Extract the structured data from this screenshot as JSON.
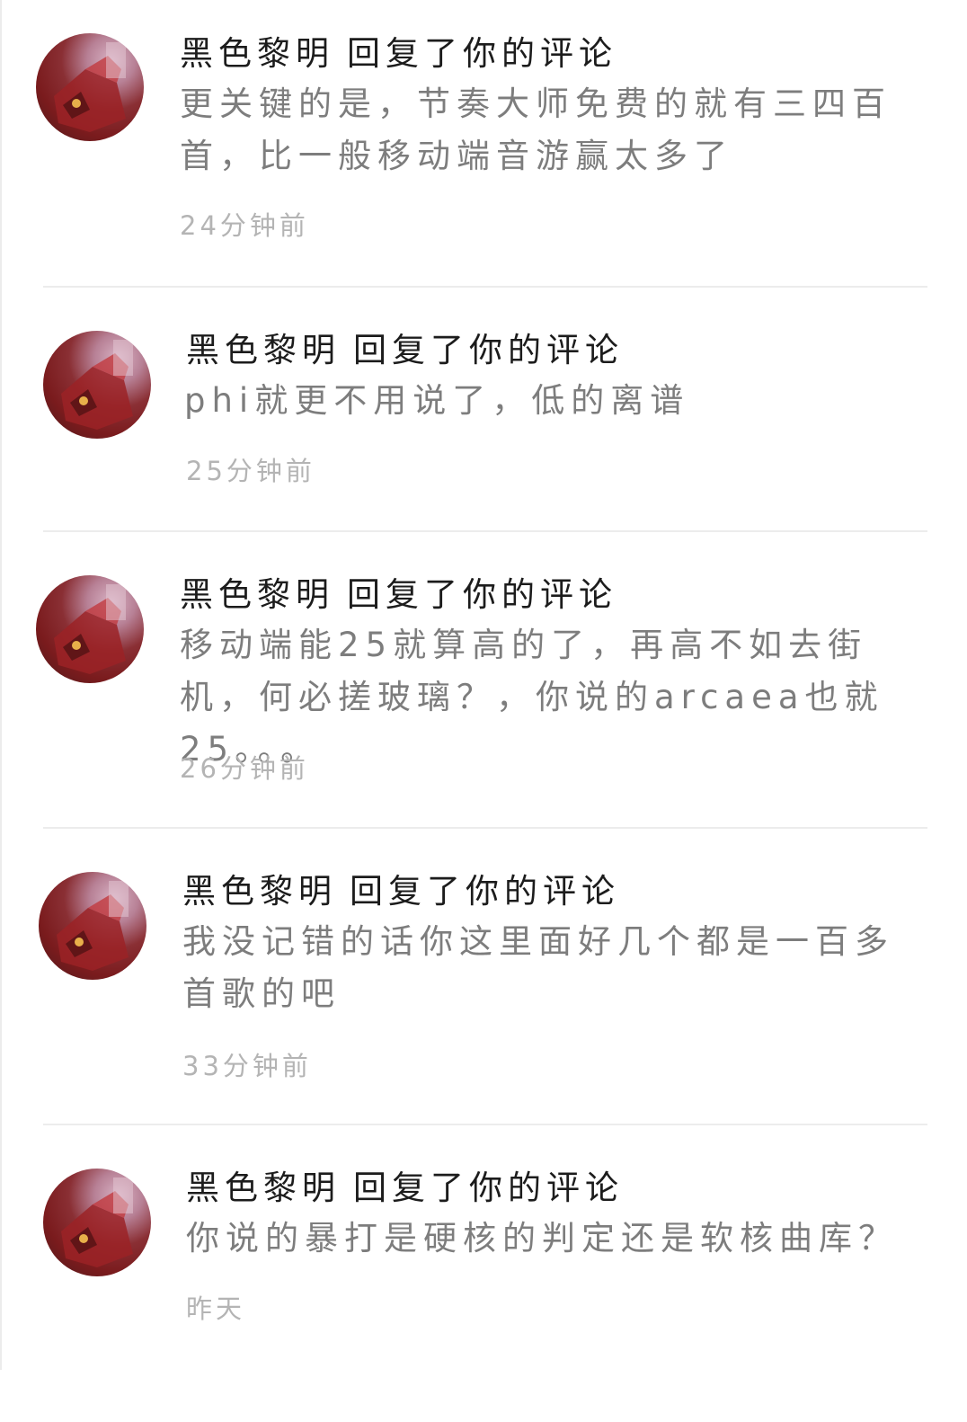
{
  "notifications": [
    {
      "user": "黑色黎明",
      "action": "回复了你的评论",
      "text": "更关键的是，节奏大师免费的就有三四百首，比一般移动端音游赢太多了",
      "time": "24分钟前",
      "avatar_icon": "user-avatar"
    },
    {
      "user": "黑色黎明",
      "action": "回复了你的评论",
      "text": "phi就更不用说了，低的离谱",
      "time": "25分钟前",
      "avatar_icon": "user-avatar"
    },
    {
      "user": "黑色黎明",
      "action": "回复了你的评论",
      "text": "移动端能25就算高的了，再高不如去街机，何必搓玻璃？，你说的arcaea也就25。。。",
      "time": "26分钟前",
      "avatar_icon": "user-avatar"
    },
    {
      "user": "黑色黎明",
      "action": "回复了你的评论",
      "text": "我没记错的话你这里面好几个都是一百多首歌的吧",
      "time": "33分钟前",
      "avatar_icon": "user-avatar"
    },
    {
      "user": "黑色黎明",
      "action": "回复了你的评论",
      "text": "你说的暴打是硬核的判定还是软核曲库？",
      "time": "昨天",
      "avatar_icon": "user-avatar"
    }
  ],
  "colors": {
    "background": "#ffffff",
    "name": "#1c1c1c",
    "body": "#7d7d7d",
    "time": "#b4b4b4",
    "divider": "#ececec"
  }
}
